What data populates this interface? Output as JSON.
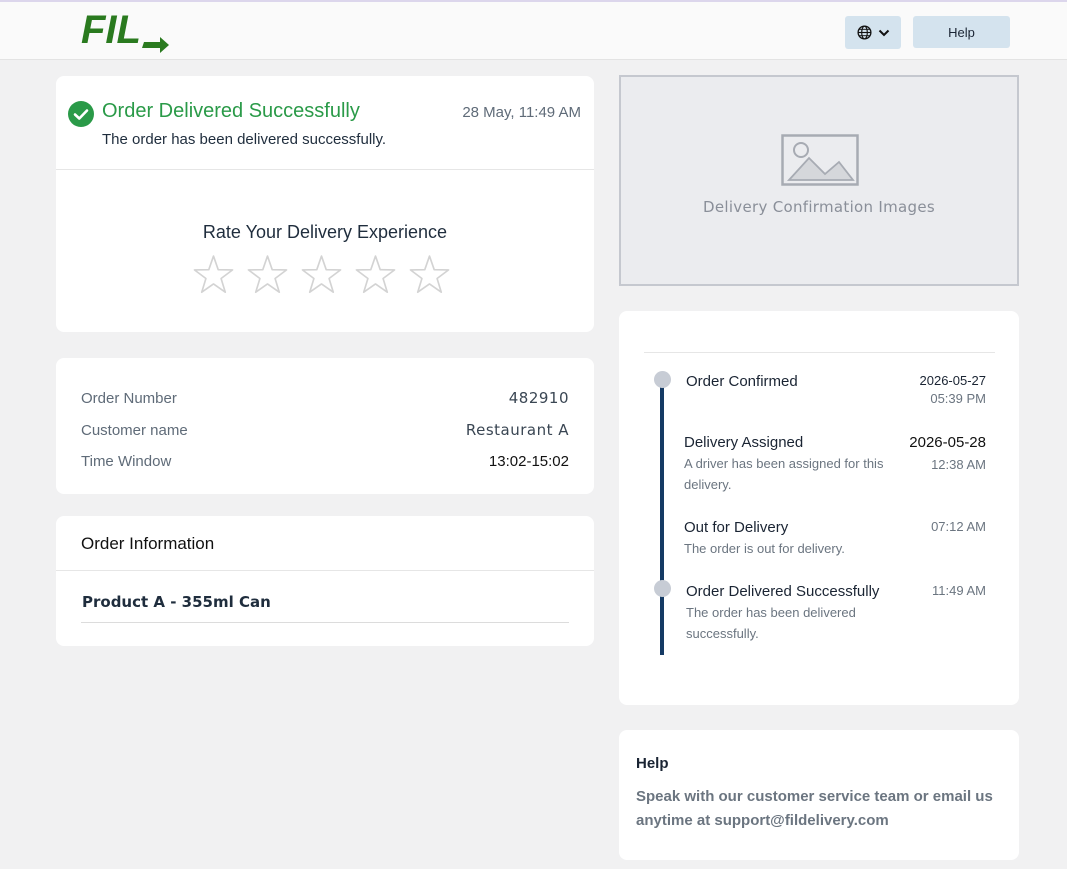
{
  "header": {
    "logo_text": "FIL",
    "language_icon": "globe-icon",
    "dropdown_icon": "chevron-down-icon",
    "help_label": "Help"
  },
  "status": {
    "icon": "check-circle-icon",
    "title": "Order Delivered Successfully",
    "time": "28 May, 11:49 AM",
    "description": "The order has been delivered successfully.",
    "accent_color": "#2a9a48"
  },
  "rating": {
    "title": "Rate Your Delivery Experience",
    "max_stars": 5,
    "selected": 0
  },
  "details": [
    {
      "label": "Order Number",
      "value": "482910"
    },
    {
      "label": "Customer name",
      "value": "Restaurant A"
    },
    {
      "label": "Time Window",
      "value": "13:02-15:02"
    }
  ],
  "order_info": {
    "title": "Order Information",
    "products": [
      "Product A - 355ml Can"
    ]
  },
  "delivery_images": {
    "icon": "image-placeholder-icon",
    "label": "Delivery Confirmation Images"
  },
  "timeline": [
    {
      "title": "Order Confirmed",
      "description": "",
      "date": "2026-05-27",
      "time": "05:39 PM"
    },
    {
      "title": "Delivery Assigned",
      "description": "A driver has been assigned for this delivery.",
      "date": "2026-05-28",
      "time": "12:38 AM"
    },
    {
      "title": "Out for Delivery",
      "description": "The order is out for delivery.",
      "date": "",
      "time": "07:12 AM"
    },
    {
      "title": "Order Delivered Successfully",
      "description": "The order has been delivered successfully.",
      "date": "",
      "time": "11:49 AM"
    }
  ],
  "help": {
    "title": "Help",
    "text": "Speak with our customer service team or email us anytime at support@fildelivery.com"
  },
  "colors": {
    "brand_green": "#2a7a1f",
    "timeline_line": "#153a64",
    "button_bg": "#d4e3ee"
  }
}
